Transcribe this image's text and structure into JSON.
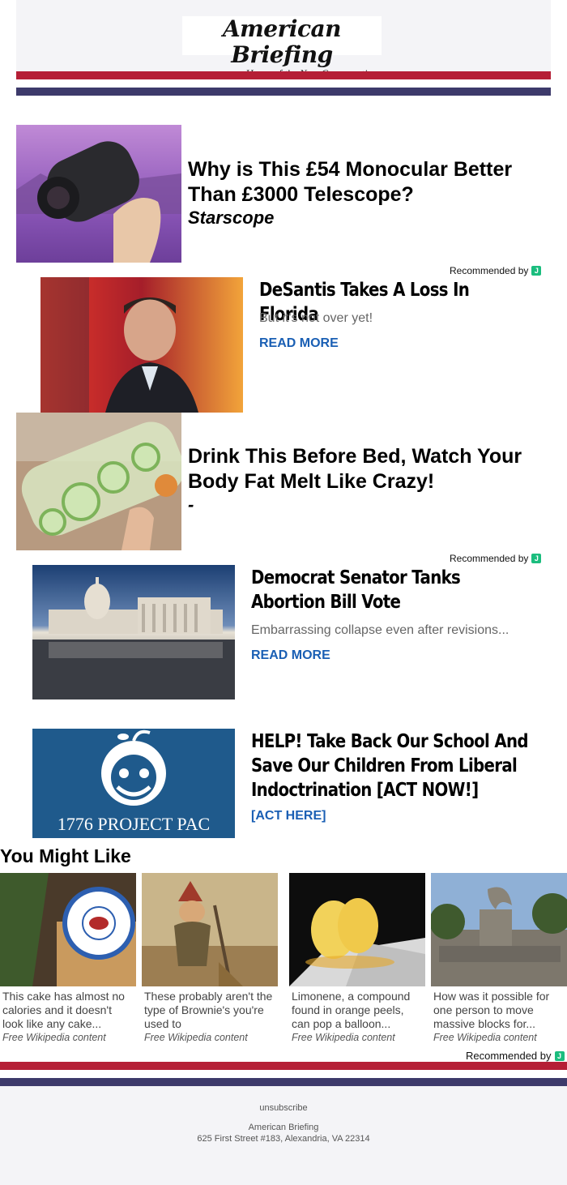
{
  "header": {
    "title": "American Briefing",
    "tagline": "Home of the New Conservative",
    "stripe_colors": [
      "#b51f36",
      "#3d3a6b"
    ]
  },
  "ads": [
    {
      "headline": "Why is This £54 Monocular Better Than £3000 Telescope?",
      "brand": "Starscope"
    },
    {
      "headline": "Drink This Before Bed, Watch Your Body Fat Melt Like Crazy!",
      "brand": "-"
    }
  ],
  "recommended_label": "Recommended by",
  "recommended_badge": "J",
  "articles": [
    {
      "title": "DeSantis Takes A Loss In Florida",
      "subtitle": "But it's not over yet!",
      "link": "READ MORE"
    },
    {
      "title": "Democrat Senator Tanks Abortion Bill Vote",
      "subtitle": "Embarrassing collapse even after revisions...",
      "link": "READ MORE"
    },
    {
      "title": "HELP! Take Back Our School And Save Our Children From Liberal Indoctrination [ACT NOW!]",
      "subtitle": "",
      "link": "[ACT HERE]",
      "image_caption": "1776 PROJECT PAC"
    }
  ],
  "you_might_like": {
    "title": "You Might Like",
    "cards": [
      {
        "text": "This cake has almost no calories and it doesn't look like any cake...",
        "source": "Free Wikipedia content"
      },
      {
        "text": "These probably aren't the type of Brownie's you're used to",
        "source": "Free Wikipedia content"
      },
      {
        "text": "Limonene, a compound found in orange peels, can pop a balloon...",
        "source": "Free Wikipedia content"
      },
      {
        "text": "How was it possible for one person to move massive blocks for...",
        "source": "Free Wikipedia content"
      }
    ]
  },
  "footer": {
    "unsubscribe": "unsubscribe",
    "org": "American Briefing",
    "address": "625 First Street #183, Alexandria, VA 22314"
  },
  "accent_link_color": "#1a5fb4"
}
